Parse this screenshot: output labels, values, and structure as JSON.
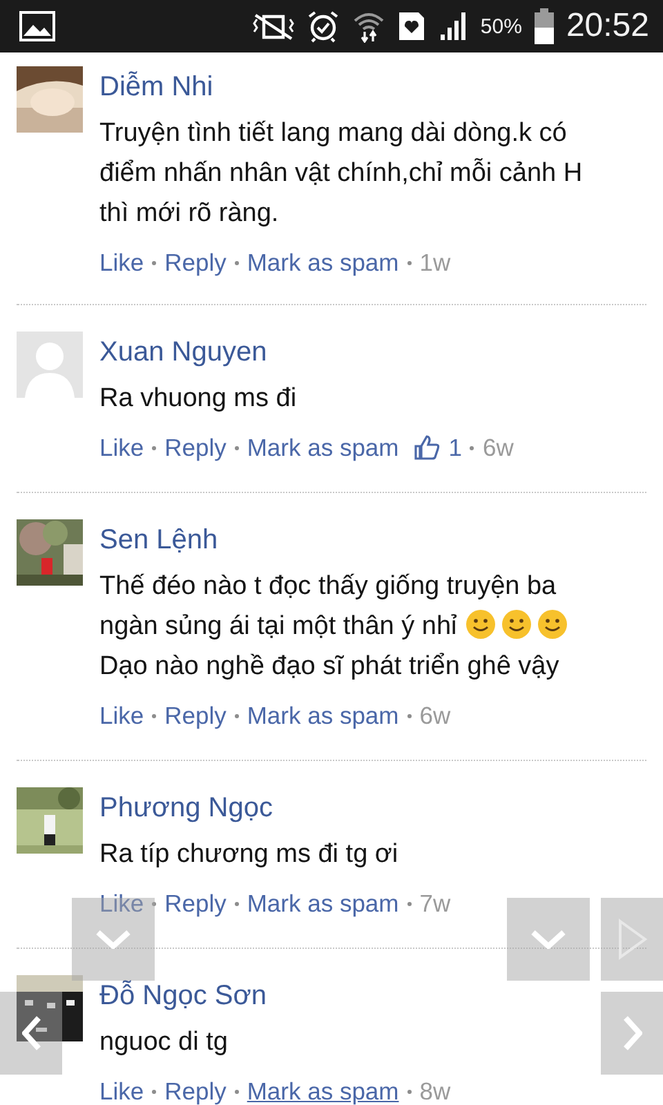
{
  "status_bar": {
    "battery": "50%",
    "time": "20:52"
  },
  "comments": [
    {
      "name": "Diễm Nhi",
      "lines": [
        "Truyện tình tiết lang mang dài dòng.k có",
        "điểm nhấn nhân vật chính,chỉ mỗi cảnh H",
        "thì mới rõ ràng."
      ],
      "actions": [
        "Like",
        "Reply",
        "Mark as spam"
      ],
      "spam_link_focused": false,
      "time": "1w"
    },
    {
      "name": "Xuan Nguyen",
      "lines": [
        "Ra vhuong ms đi"
      ],
      "actions": [
        "Like",
        "Reply",
        "Mark as spam"
      ],
      "spam_link_focused": false,
      "likes": "1",
      "time": "6w"
    },
    {
      "name": "Sen Lệnh",
      "lines": [
        "Thế đéo nào t đọc thấy giống truyện ba",
        "ngàn sủng ái tại một thân ý nhỉ",
        "Dạo nào nghề đạo sĩ phát triển ghê vậy"
      ],
      "emojis": [
        {
          "kind": "smile"
        },
        {
          "kind": "smile"
        },
        {
          "kind": "smile"
        }
      ],
      "actions": [
        "Like",
        "Reply",
        "Mark as spam"
      ],
      "spam_link_focused": false,
      "time": "6w"
    },
    {
      "name": "Phương Ngọc",
      "lines": [
        "Ra típ chương ms đi tg ơi"
      ],
      "actions": [
        "Like",
        "Reply",
        "Mark as spam"
      ],
      "spam_link_focused": false,
      "time": "7w"
    },
    {
      "name": "Đỗ Ngọc Sơn",
      "lines": [
        "nguoc di tg"
      ],
      "actions": [
        "Like",
        "Reply",
        "Mark as spam"
      ],
      "spam_link_focused": true,
      "time": "8w"
    }
  ],
  "overlay_buttons": [
    {
      "kind": "down"
    },
    {
      "kind": "down"
    },
    {
      "kind": "play"
    },
    {
      "kind": "left"
    },
    {
      "kind": "right"
    }
  ]
}
